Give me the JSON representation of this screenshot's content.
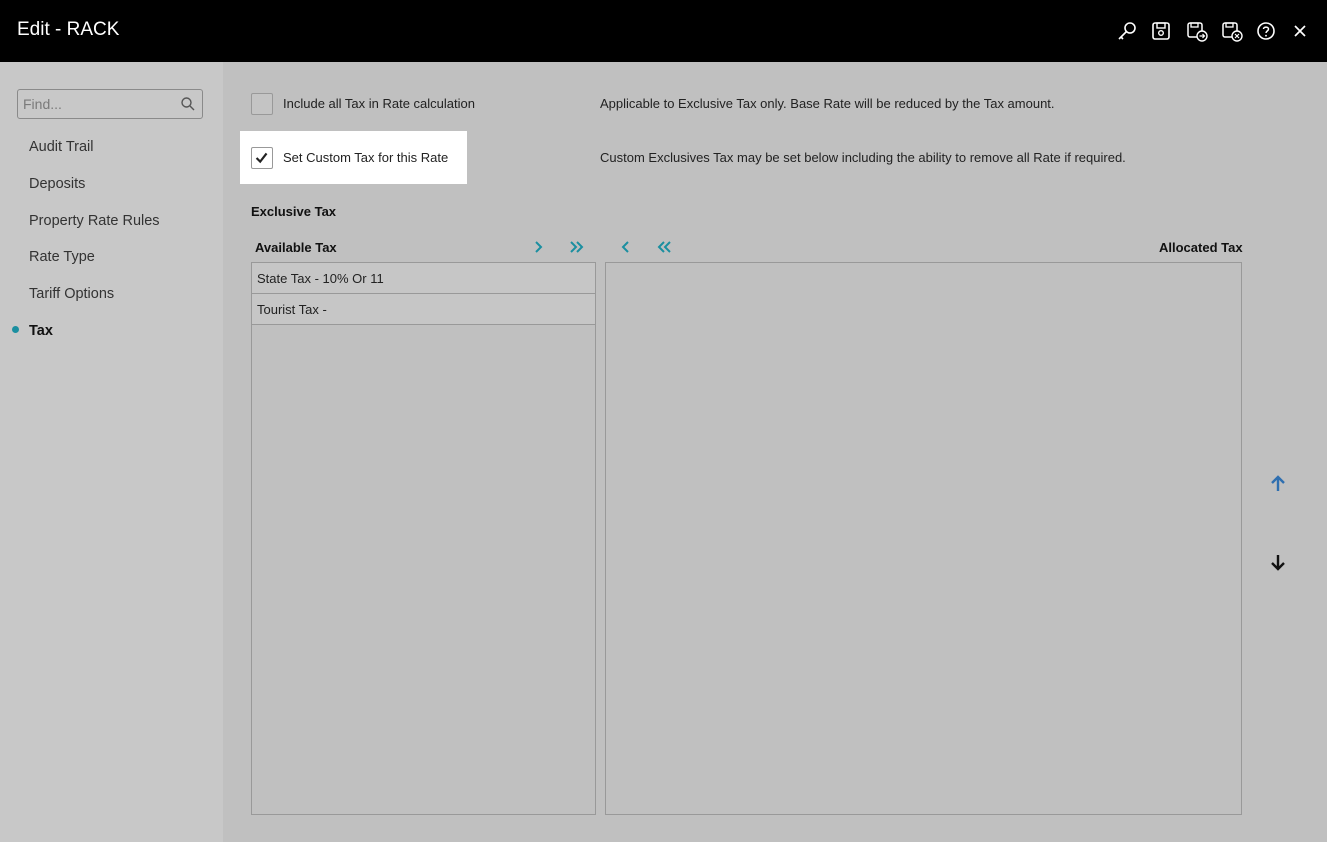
{
  "window": {
    "title": "Edit - RACK"
  },
  "toolbar": {
    "icons": [
      "key-icon",
      "save-icon",
      "save-and-next-icon",
      "save-and-close-icon",
      "help-icon",
      "close-icon"
    ]
  },
  "sidebar": {
    "search_placeholder": "Find...",
    "items": [
      {
        "label": "Audit Trail",
        "active": false
      },
      {
        "label": "Deposits",
        "active": false
      },
      {
        "label": "Property Rate Rules",
        "active": false
      },
      {
        "label": "Rate Type",
        "active": false
      },
      {
        "label": "Tariff Options",
        "active": false
      },
      {
        "label": "Tax",
        "active": true
      }
    ]
  },
  "options": {
    "include_tax": {
      "label": "Include all Tax in Rate calculation",
      "checked": false,
      "hint": "Applicable to Exclusive Tax only. Base Rate will be reduced by the Tax amount."
    },
    "custom_tax": {
      "label": "Set Custom Tax for this Rate",
      "checked": true,
      "hint": "Custom Exclusives Tax may be set below including the ability to remove all Rate if required."
    }
  },
  "exclusive_tax": {
    "section_title": "Exclusive Tax",
    "available_header": "Available Tax",
    "allocated_header": "Allocated Tax",
    "available_items": [
      "State Tax - 10% Or 11",
      "Tourist Tax -"
    ],
    "allocated_items": []
  },
  "colors": {
    "accent": "#1b8fa0",
    "move_up": "#2f6fb0",
    "titlebar": "#000000"
  }
}
